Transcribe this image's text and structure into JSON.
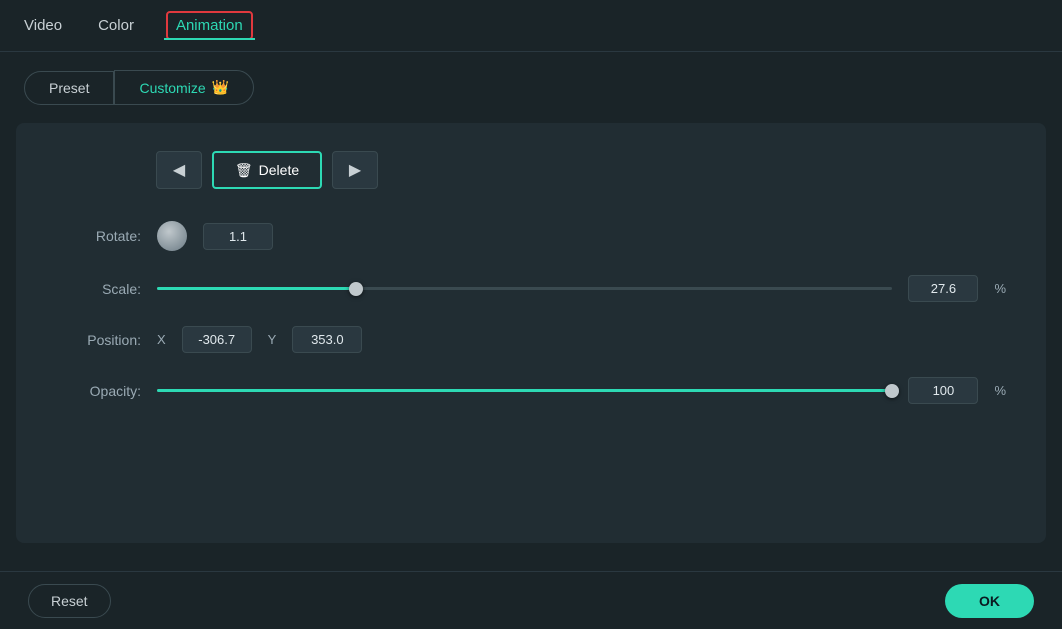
{
  "nav": {
    "tabs": [
      {
        "id": "video",
        "label": "Video",
        "active": false
      },
      {
        "id": "color",
        "label": "Color",
        "active": false
      },
      {
        "id": "animation",
        "label": "Animation",
        "active": true
      }
    ]
  },
  "subtabs": {
    "preset": {
      "label": "Preset",
      "active": false
    },
    "customize": {
      "label": "Customize",
      "active": true,
      "crown": "👑"
    }
  },
  "actions": {
    "prev_label": "◀",
    "delete_label": "Delete",
    "next_label": "▶"
  },
  "controls": {
    "rotate": {
      "label": "Rotate:",
      "value": "1.1"
    },
    "scale": {
      "label": "Scale:",
      "value": "27.6",
      "unit": "%",
      "slider_pct": 27
    },
    "position": {
      "label": "Position:",
      "x_label": "X",
      "x_value": "-306.7",
      "y_label": "Y",
      "y_value": "353.0"
    },
    "opacity": {
      "label": "Opacity:",
      "value": "100",
      "unit": "%",
      "slider_pct": 100
    }
  },
  "footer": {
    "reset_label": "Reset",
    "ok_label": "OK"
  }
}
